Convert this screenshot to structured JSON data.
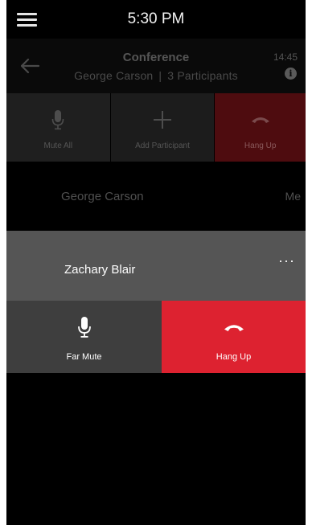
{
  "status_bar": {
    "time": "5:30 PM",
    "menu_icon": "hamburger-menu-icon"
  },
  "conference": {
    "title": "Conference",
    "host": "George Carson",
    "separator": "|",
    "participants": "3 Participants",
    "duration": "14:45",
    "back_icon": "back-arrow-icon",
    "info_icon": "info-icon",
    "info_glyph": "i"
  },
  "actions": [
    {
      "label": "Mute All",
      "icon": "microphone-icon"
    },
    {
      "label": "Add Participant",
      "icon": "plus-icon"
    },
    {
      "label": "Hang Up",
      "icon": "hang-up-icon"
    }
  ],
  "participants": [
    {
      "name": "George Carson",
      "tag": "Me"
    },
    {
      "name": "Zachary Blair",
      "more": "···"
    }
  ],
  "participant_actions": [
    {
      "label": "Far Mute",
      "icon": "microphone-icon"
    },
    {
      "label": "Hang Up",
      "icon": "hang-up-icon"
    }
  ],
  "colors": {
    "background": "#000000",
    "selected_row": "#555555",
    "hang_up": "#dd2230",
    "hang_up_dimmed": "#4e0c0f",
    "button_gray": "#3e3e3e"
  }
}
